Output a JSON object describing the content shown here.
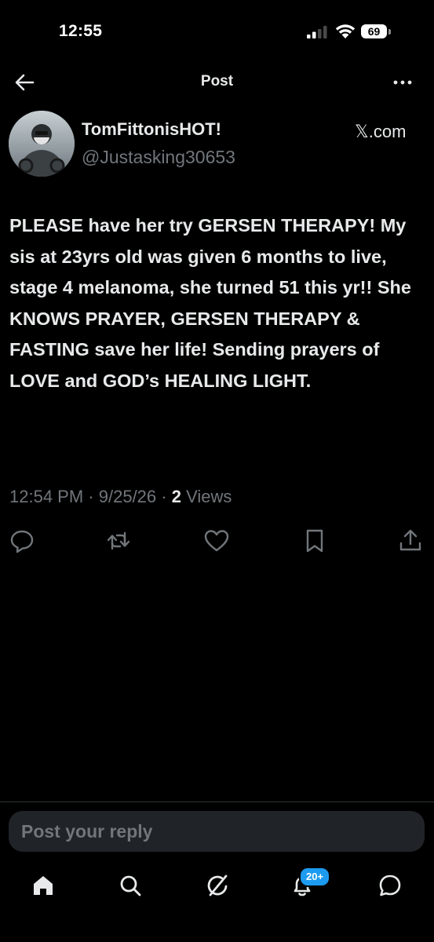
{
  "status_bar": {
    "time": "12:55",
    "battery_level": "69",
    "icons": [
      "signal-icon",
      "wifi-icon",
      "battery-icon"
    ]
  },
  "header": {
    "title": "Post",
    "back_icon": "arrow-left-icon",
    "more_icon": "more-horizontal-icon"
  },
  "author": {
    "name": "TomFittonisHOT!",
    "handle": "@Justasking30653",
    "source": "𝕏.com"
  },
  "post": {
    "text": "PLEASE have her try GERSEN THERAPY! My sis at 23yrs old was given 6 months to live, stage 4 melanoma, she turned 51 this yr!! She KNOWS PRAYER, GERSEN THERAPY & FASTING save her life! Sending prayers of LOVE and GOD’s HEALING LIGHT.",
    "time": "12:54 PM",
    "separator": "·",
    "date": "9/25/26",
    "views_count": "2",
    "views_label": "Views"
  },
  "actions": [
    "reply-icon",
    "retweet-icon",
    "like-icon",
    "bookmark-icon",
    "share-icon"
  ],
  "reply": {
    "placeholder": "Post your reply"
  },
  "bottom_nav": {
    "items": [
      "home-icon",
      "search-icon",
      "grok-icon",
      "notifications-icon",
      "messages-icon"
    ],
    "notification_badge": "20+"
  },
  "colors": {
    "background": "#000000",
    "text_primary": "#e7e9ea",
    "text_secondary": "#71767b",
    "accent": "#1d9bf0",
    "reply_box": "#202327"
  }
}
